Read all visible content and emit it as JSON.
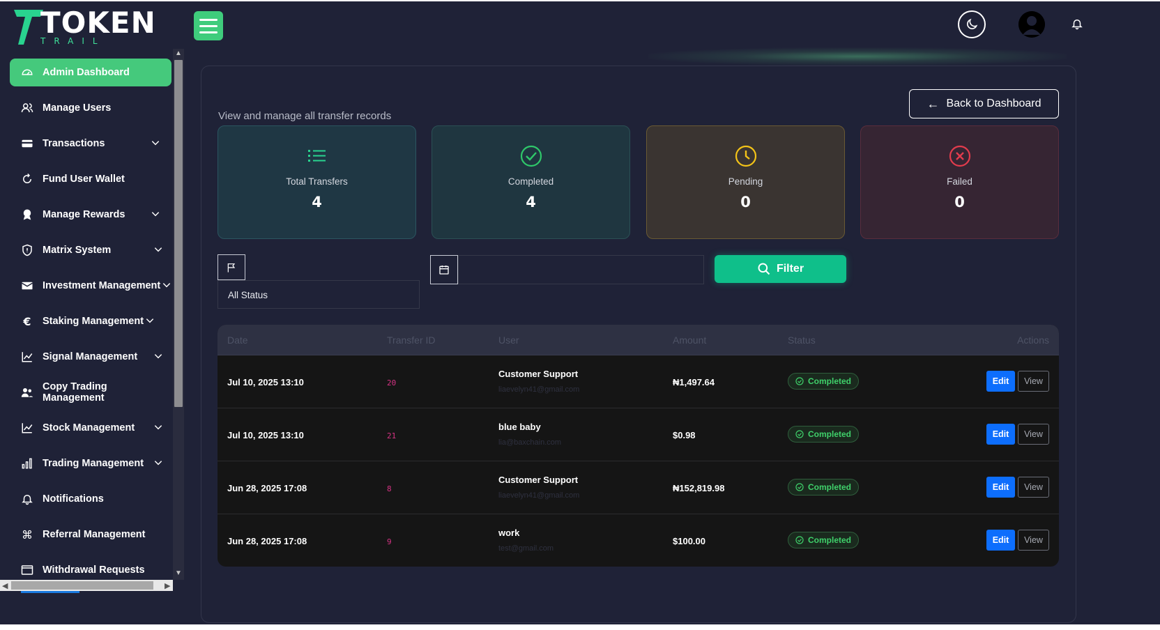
{
  "brand": {
    "logo_main": "TOKEN",
    "logo_sub": "TRAIL"
  },
  "sidebar": {
    "items": [
      {
        "label": "Admin Dashboard",
        "icon": "gauge-icon",
        "active": true,
        "expandable": false
      },
      {
        "label": "Manage Users",
        "icon": "users-icon",
        "active": false,
        "expandable": false
      },
      {
        "label": "Transactions",
        "icon": "credit-card-icon",
        "active": false,
        "expandable": true
      },
      {
        "label": "Fund User Wallet",
        "icon": "refresh-icon",
        "active": false,
        "expandable": false
      },
      {
        "label": "Manage Rewards",
        "icon": "award-icon",
        "active": false,
        "expandable": true
      },
      {
        "label": "Matrix System",
        "icon": "shield-icon",
        "active": false,
        "expandable": true
      },
      {
        "label": "Investment Management",
        "icon": "envelope-icon",
        "active": false,
        "expandable": true
      },
      {
        "label": "Staking Management",
        "icon": "euro-icon",
        "active": false,
        "expandable": true
      },
      {
        "label": "Signal Management",
        "icon": "chart-line-icon",
        "active": false,
        "expandable": true
      },
      {
        "label": "Copy Trading Management",
        "icon": "people-icon",
        "active": false,
        "expandable": false
      },
      {
        "label": "Stock Management",
        "icon": "chart-line-icon",
        "active": false,
        "expandable": true
      },
      {
        "label": "Trading Management",
        "icon": "bar-chart-icon",
        "active": false,
        "expandable": true
      },
      {
        "label": "Notifications",
        "icon": "bell-icon",
        "active": false,
        "expandable": false
      },
      {
        "label": "Referral Management",
        "icon": "command-icon",
        "active": false,
        "expandable": false
      },
      {
        "label": "Withdrawal Requests",
        "icon": "window-icon",
        "active": false,
        "expandable": false
      }
    ]
  },
  "header": {
    "back_label": "Back to Dashboard",
    "subtitle": "View and manage all transfer records"
  },
  "stats": [
    {
      "label": "Total Transfers",
      "value": "4",
      "icon": "list-icon",
      "color": "#29d38f"
    },
    {
      "label": "Completed",
      "value": "4",
      "icon": "check-circle-icon",
      "color": "#2fc86a"
    },
    {
      "label": "Pending",
      "value": "0",
      "icon": "clock-icon",
      "color": "#f3c318"
    },
    {
      "label": "Failed",
      "value": "0",
      "icon": "x-circle-icon",
      "color": "#e23c4d"
    }
  ],
  "filters": {
    "status_selected": "All Status",
    "date_value": "",
    "filter_label": "Filter"
  },
  "table": {
    "headers": [
      "Date",
      "Transfer ID",
      "User",
      "Amount",
      "Status",
      "Actions"
    ],
    "rows": [
      {
        "date": "Jul 10, 2025 13:10",
        "id": "20",
        "user": "Customer Support",
        "email": "liaevelyn41@gmail.com",
        "amount": "₦1,497.64",
        "status": "Completed",
        "edit": "Edit",
        "view": "View"
      },
      {
        "date": "Jul 10, 2025 13:10",
        "id": "21",
        "user": "blue baby",
        "email": "lia@baxchain.com",
        "amount": "$0.98",
        "status": "Completed",
        "edit": "Edit",
        "view": "View"
      },
      {
        "date": "Jun 28, 2025 17:08",
        "id": "8",
        "user": "Customer Support",
        "email": "liaevelyn41@gmail.com",
        "amount": "₦152,819.98",
        "status": "Completed",
        "edit": "Edit",
        "view": "View"
      },
      {
        "date": "Jun 28, 2025 17:08",
        "id": "9",
        "user": "work",
        "email": "test@gmail.com",
        "amount": "$100.00",
        "status": "Completed",
        "edit": "Edit",
        "view": "View"
      }
    ]
  },
  "colors": {
    "background": "#1f2237",
    "accent_green": "#45c97c",
    "filter_button": "#0fbf8a",
    "edit_button": "#0d6efd",
    "status_completed": "#3fd06a"
  }
}
